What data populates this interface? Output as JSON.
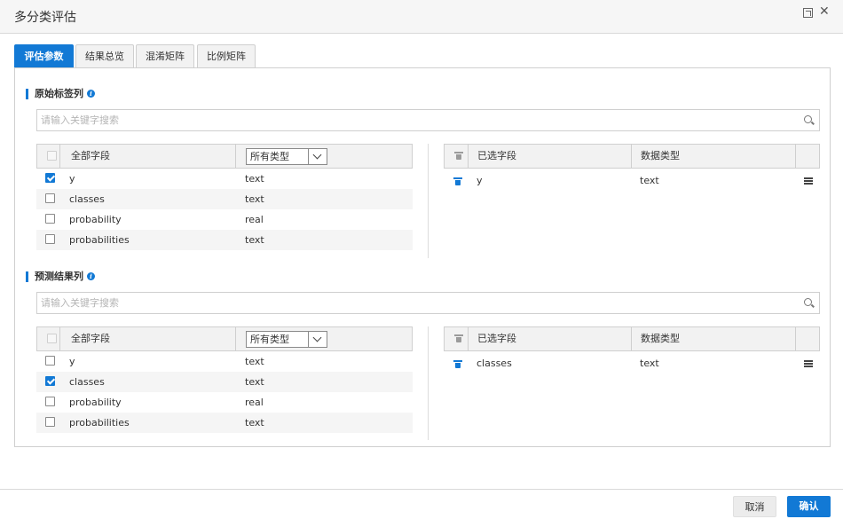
{
  "dialog": {
    "title": "多分类评估"
  },
  "tabs": [
    {
      "label": "评估参数",
      "active": true
    },
    {
      "label": "结果总览",
      "active": false
    },
    {
      "label": "混淆矩阵",
      "active": false
    },
    {
      "label": "比例矩阵",
      "active": false
    }
  ],
  "sections": [
    {
      "title": "原始标签列",
      "search_placeholder": "请输入关键字搜索",
      "left": {
        "header_field": "全部字段",
        "type_filter": "所有类型",
        "rows": [
          {
            "name": "y",
            "type": "text",
            "checked": true
          },
          {
            "name": "classes",
            "type": "text",
            "checked": false
          },
          {
            "name": "probability",
            "type": "real",
            "checked": false
          },
          {
            "name": "probabilities",
            "type": "text",
            "checked": false
          }
        ]
      },
      "right": {
        "header_selected": "已选字段",
        "header_type": "数据类型",
        "rows": [
          {
            "name": "y",
            "type": "text"
          }
        ]
      }
    },
    {
      "title": "预测结果列",
      "search_placeholder": "请输入关键字搜索",
      "left": {
        "header_field": "全部字段",
        "type_filter": "所有类型",
        "rows": [
          {
            "name": "y",
            "type": "text",
            "checked": false
          },
          {
            "name": "classes",
            "type": "text",
            "checked": true
          },
          {
            "name": "probability",
            "type": "real",
            "checked": false
          },
          {
            "name": "probabilities",
            "type": "text",
            "checked": false
          }
        ]
      },
      "right": {
        "header_selected": "已选字段",
        "header_type": "数据类型",
        "rows": [
          {
            "name": "classes",
            "type": "text"
          }
        ]
      }
    }
  ],
  "footer": {
    "cancel_label": "取消",
    "ok_label": "确认"
  },
  "colors": {
    "accent": "#1279d5",
    "border": "#cfcfcf",
    "header_bg": "#f2f2f2"
  }
}
